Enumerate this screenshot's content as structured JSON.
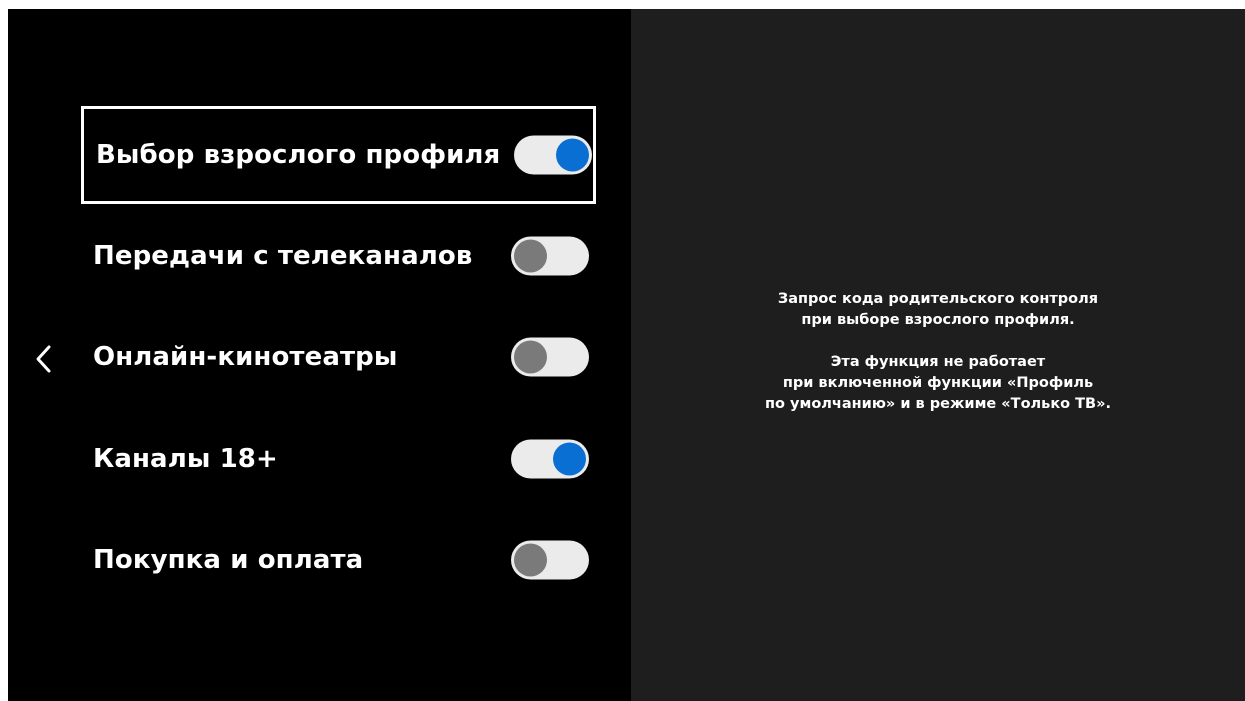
{
  "menu": {
    "items": [
      {
        "label": "Выбор взрослого профиля",
        "toggle_on": true,
        "focused": true
      },
      {
        "label": "Передачи с телеканалов",
        "toggle_on": false,
        "focused": false
      },
      {
        "label": "Онлайн-кинотеатры",
        "toggle_on": false,
        "focused": false
      },
      {
        "label": "Каналы 18+",
        "toggle_on": true,
        "focused": false
      },
      {
        "label": "Покупка и оплата",
        "toggle_on": false,
        "focused": false
      }
    ]
  },
  "description": {
    "lines": [
      "Запрос кода родительского контроля",
      "при выборе взрослого профиля.",
      "Эта функция не работает",
      "при включенной функции «Профиль",
      "по умолчанию» и в режиме «Только ТВ»."
    ]
  },
  "icons": {
    "back": "chevron-left-icon"
  },
  "colors": {
    "background": "#000000",
    "panel": "#1e1e1e",
    "toggle_on_knob": "#0a6fd3",
    "toggle_off_knob": "#7a7a7a",
    "toggle_track": "#ebebeb",
    "focus_border": "#ffffff"
  }
}
